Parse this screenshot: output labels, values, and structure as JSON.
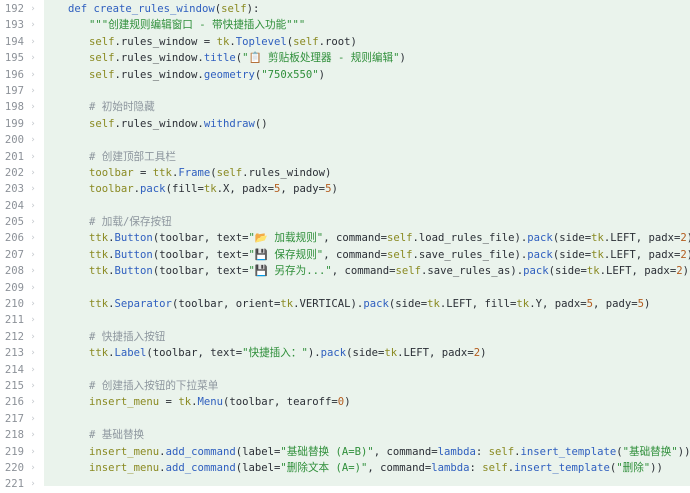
{
  "editor": {
    "lines": [
      {
        "n": "192",
        "indent": 1,
        "tokens": [
          {
            "t": "def ",
            "c": "kw"
          },
          {
            "t": "create_rules_window",
            "c": "fn"
          },
          {
            "t": "(",
            "c": "p"
          },
          {
            "t": "self",
            "c": "self"
          },
          {
            "t": "):",
            "c": "p"
          }
        ]
      },
      {
        "n": "193",
        "indent": 2,
        "tokens": [
          {
            "t": "\"\"\"创建规则编辑窗口 - 带快捷插入功能\"\"\"",
            "c": "str"
          }
        ]
      },
      {
        "n": "194",
        "indent": 2,
        "tokens": [
          {
            "t": "self",
            "c": "self"
          },
          {
            "t": ".rules_window = ",
            "c": "p"
          },
          {
            "t": "tk",
            "c": "self"
          },
          {
            "t": ".",
            "c": "p"
          },
          {
            "t": "Toplevel",
            "c": "cls"
          },
          {
            "t": "(",
            "c": "p"
          },
          {
            "t": "self",
            "c": "self"
          },
          {
            "t": ".root)",
            "c": "p"
          }
        ]
      },
      {
        "n": "195",
        "indent": 2,
        "tokens": [
          {
            "t": "self",
            "c": "self"
          },
          {
            "t": ".rules_window.",
            "c": "p"
          },
          {
            "t": "title",
            "c": "fn"
          },
          {
            "t": "(",
            "c": "p"
          },
          {
            "t": "\"📋 剪贴板处理器 - 规则编辑\"",
            "c": "str"
          },
          {
            "t": ")",
            "c": "p"
          }
        ]
      },
      {
        "n": "196",
        "indent": 2,
        "tokens": [
          {
            "t": "self",
            "c": "self"
          },
          {
            "t": ".rules_window.",
            "c": "p"
          },
          {
            "t": "geometry",
            "c": "fn"
          },
          {
            "t": "(",
            "c": "p"
          },
          {
            "t": "\"750x550\"",
            "c": "str"
          },
          {
            "t": ")",
            "c": "p"
          }
        ]
      },
      {
        "n": "197",
        "indent": 0,
        "tokens": []
      },
      {
        "n": "198",
        "indent": 2,
        "tokens": [
          {
            "t": "# 初始时隐藏",
            "c": "cm"
          }
        ]
      },
      {
        "n": "199",
        "indent": 2,
        "tokens": [
          {
            "t": "self",
            "c": "self"
          },
          {
            "t": ".rules_window.",
            "c": "p"
          },
          {
            "t": "withdraw",
            "c": "fn"
          },
          {
            "t": "()",
            "c": "p"
          }
        ]
      },
      {
        "n": "200",
        "indent": 0,
        "tokens": []
      },
      {
        "n": "201",
        "indent": 2,
        "tokens": [
          {
            "t": "# 创建顶部工具栏",
            "c": "cm"
          }
        ]
      },
      {
        "n": "202",
        "indent": 2,
        "tokens": [
          {
            "t": "toolbar",
            "c": "self"
          },
          {
            "t": " = ",
            "c": "p"
          },
          {
            "t": "ttk",
            "c": "self"
          },
          {
            "t": ".",
            "c": "p"
          },
          {
            "t": "Frame",
            "c": "cls"
          },
          {
            "t": "(",
            "c": "p"
          },
          {
            "t": "self",
            "c": "self"
          },
          {
            "t": ".rules_window)",
            "c": "p"
          }
        ]
      },
      {
        "n": "203",
        "indent": 2,
        "tokens": [
          {
            "t": "toolbar",
            "c": "self"
          },
          {
            "t": ".",
            "c": "p"
          },
          {
            "t": "pack",
            "c": "fn"
          },
          {
            "t": "(fill=",
            "c": "p"
          },
          {
            "t": "tk",
            "c": "self"
          },
          {
            "t": ".X, padx=",
            "c": "p"
          },
          {
            "t": "5",
            "c": "num"
          },
          {
            "t": ", pady=",
            "c": "p"
          },
          {
            "t": "5",
            "c": "num"
          },
          {
            "t": ")",
            "c": "p"
          }
        ]
      },
      {
        "n": "204",
        "indent": 0,
        "tokens": []
      },
      {
        "n": "205",
        "indent": 2,
        "tokens": [
          {
            "t": "# 加载/保存按钮",
            "c": "cm"
          }
        ]
      },
      {
        "n": "206",
        "indent": 2,
        "tokens": [
          {
            "t": "ttk",
            "c": "self"
          },
          {
            "t": ".",
            "c": "p"
          },
          {
            "t": "Button",
            "c": "cls"
          },
          {
            "t": "(toolbar, text=",
            "c": "p"
          },
          {
            "t": "\"📂 加载规则\"",
            "c": "str"
          },
          {
            "t": ", command=",
            "c": "p"
          },
          {
            "t": "self",
            "c": "self"
          },
          {
            "t": ".load_rules_file).",
            "c": "p"
          },
          {
            "t": "pack",
            "c": "fn"
          },
          {
            "t": "(side=",
            "c": "p"
          },
          {
            "t": "tk",
            "c": "self"
          },
          {
            "t": ".LEFT, padx=",
            "c": "p"
          },
          {
            "t": "2",
            "c": "num"
          },
          {
            "t": ")",
            "c": "p"
          }
        ]
      },
      {
        "n": "207",
        "indent": 2,
        "tokens": [
          {
            "t": "ttk",
            "c": "self"
          },
          {
            "t": ".",
            "c": "p"
          },
          {
            "t": "Button",
            "c": "cls"
          },
          {
            "t": "(toolbar, text=",
            "c": "p"
          },
          {
            "t": "\"💾 保存规则\"",
            "c": "str"
          },
          {
            "t": ", command=",
            "c": "p"
          },
          {
            "t": "self",
            "c": "self"
          },
          {
            "t": ".save_rules_file).",
            "c": "p"
          },
          {
            "t": "pack",
            "c": "fn"
          },
          {
            "t": "(side=",
            "c": "p"
          },
          {
            "t": "tk",
            "c": "self"
          },
          {
            "t": ".LEFT, padx=",
            "c": "p"
          },
          {
            "t": "2",
            "c": "num"
          },
          {
            "t": ")",
            "c": "p"
          }
        ]
      },
      {
        "n": "208",
        "indent": 2,
        "tokens": [
          {
            "t": "ttk",
            "c": "self"
          },
          {
            "t": ".",
            "c": "p"
          },
          {
            "t": "Button",
            "c": "cls"
          },
          {
            "t": "(toolbar, text=",
            "c": "p"
          },
          {
            "t": "\"💾 另存为...\"",
            "c": "str"
          },
          {
            "t": ", command=",
            "c": "p"
          },
          {
            "t": "self",
            "c": "self"
          },
          {
            "t": ".save_rules_as).",
            "c": "p"
          },
          {
            "t": "pack",
            "c": "fn"
          },
          {
            "t": "(side=",
            "c": "p"
          },
          {
            "t": "tk",
            "c": "self"
          },
          {
            "t": ".LEFT, padx=",
            "c": "p"
          },
          {
            "t": "2",
            "c": "num"
          },
          {
            "t": ")",
            "c": "p"
          }
        ]
      },
      {
        "n": "209",
        "indent": 0,
        "tokens": []
      },
      {
        "n": "210",
        "indent": 2,
        "tokens": [
          {
            "t": "ttk",
            "c": "self"
          },
          {
            "t": ".",
            "c": "p"
          },
          {
            "t": "Separator",
            "c": "cls"
          },
          {
            "t": "(toolbar, orient=",
            "c": "p"
          },
          {
            "t": "tk",
            "c": "self"
          },
          {
            "t": ".VERTICAL).",
            "c": "p"
          },
          {
            "t": "pack",
            "c": "fn"
          },
          {
            "t": "(side=",
            "c": "p"
          },
          {
            "t": "tk",
            "c": "self"
          },
          {
            "t": ".LEFT, fill=",
            "c": "p"
          },
          {
            "t": "tk",
            "c": "self"
          },
          {
            "t": ".Y, padx=",
            "c": "p"
          },
          {
            "t": "5",
            "c": "num"
          },
          {
            "t": ", pady=",
            "c": "p"
          },
          {
            "t": "5",
            "c": "num"
          },
          {
            "t": ")",
            "c": "p"
          }
        ]
      },
      {
        "n": "211",
        "indent": 0,
        "tokens": []
      },
      {
        "n": "212",
        "indent": 2,
        "tokens": [
          {
            "t": "# 快捷插入按钮",
            "c": "cm"
          }
        ]
      },
      {
        "n": "213",
        "indent": 2,
        "tokens": [
          {
            "t": "ttk",
            "c": "self"
          },
          {
            "t": ".",
            "c": "p"
          },
          {
            "t": "Label",
            "c": "cls"
          },
          {
            "t": "(toolbar, text=",
            "c": "p"
          },
          {
            "t": "\"快捷插入：\"",
            "c": "str"
          },
          {
            "t": ").",
            "c": "p"
          },
          {
            "t": "pack",
            "c": "fn"
          },
          {
            "t": "(side=",
            "c": "p"
          },
          {
            "t": "tk",
            "c": "self"
          },
          {
            "t": ".LEFT, padx=",
            "c": "p"
          },
          {
            "t": "2",
            "c": "num"
          },
          {
            "t": ")",
            "c": "p"
          }
        ]
      },
      {
        "n": "214",
        "indent": 0,
        "tokens": []
      },
      {
        "n": "215",
        "indent": 2,
        "tokens": [
          {
            "t": "# 创建插入按钮的下拉菜单",
            "c": "cm"
          }
        ]
      },
      {
        "n": "216",
        "indent": 2,
        "tokens": [
          {
            "t": "insert_menu",
            "c": "self"
          },
          {
            "t": " = ",
            "c": "p"
          },
          {
            "t": "tk",
            "c": "self"
          },
          {
            "t": ".",
            "c": "p"
          },
          {
            "t": "Menu",
            "c": "cls"
          },
          {
            "t": "(toolbar, tearoff=",
            "c": "p"
          },
          {
            "t": "0",
            "c": "num"
          },
          {
            "t": ")",
            "c": "p"
          }
        ]
      },
      {
        "n": "217",
        "indent": 0,
        "tokens": []
      },
      {
        "n": "218",
        "indent": 2,
        "tokens": [
          {
            "t": "# 基础替换",
            "c": "cm"
          }
        ]
      },
      {
        "n": "219",
        "indent": 2,
        "tokens": [
          {
            "t": "insert_menu",
            "c": "self"
          },
          {
            "t": ".",
            "c": "p"
          },
          {
            "t": "add_command",
            "c": "fn"
          },
          {
            "t": "(label=",
            "c": "p"
          },
          {
            "t": "\"基础替换 (A=B)\"",
            "c": "str"
          },
          {
            "t": ", command=",
            "c": "p"
          },
          {
            "t": "lambda",
            "c": "kw"
          },
          {
            "t": ": ",
            "c": "p"
          },
          {
            "t": "self",
            "c": "self"
          },
          {
            "t": ".",
            "c": "p"
          },
          {
            "t": "insert_template",
            "c": "fn"
          },
          {
            "t": "(",
            "c": "p"
          },
          {
            "t": "\"基础替换\"",
            "c": "str"
          },
          {
            "t": "))",
            "c": "p"
          }
        ]
      },
      {
        "n": "220",
        "indent": 2,
        "tokens": [
          {
            "t": "insert_menu",
            "c": "self"
          },
          {
            "t": ".",
            "c": "p"
          },
          {
            "t": "add_command",
            "c": "fn"
          },
          {
            "t": "(label=",
            "c": "p"
          },
          {
            "t": "\"删除文本 (A=)\"",
            "c": "str"
          },
          {
            "t": ", command=",
            "c": "p"
          },
          {
            "t": "lambda",
            "c": "kw"
          },
          {
            "t": ": ",
            "c": "p"
          },
          {
            "t": "self",
            "c": "self"
          },
          {
            "t": ".",
            "c": "p"
          },
          {
            "t": "insert_template",
            "c": "fn"
          },
          {
            "t": "(",
            "c": "p"
          },
          {
            "t": "\"删除\"",
            "c": "str"
          },
          {
            "t": "))",
            "c": "p"
          }
        ]
      },
      {
        "n": "221",
        "indent": 0,
        "tokens": []
      }
    ]
  }
}
